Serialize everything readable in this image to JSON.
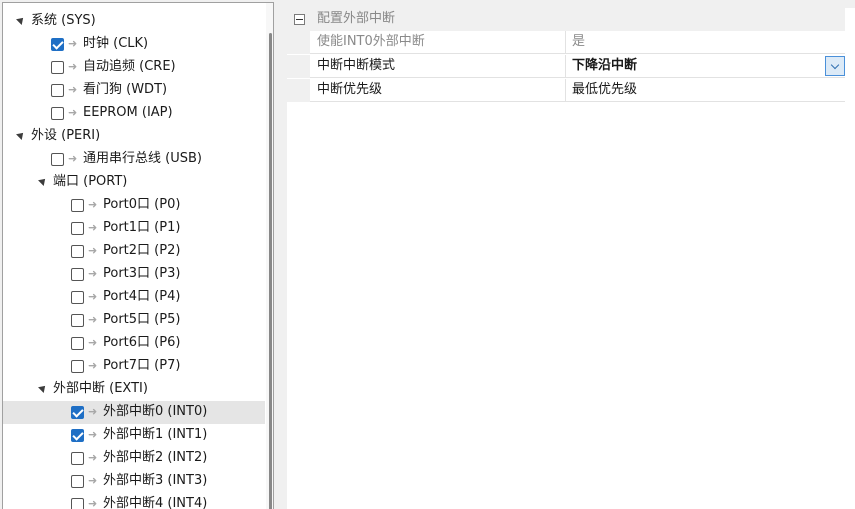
{
  "tree": {
    "nodes": [
      {
        "level": 0,
        "type": "group",
        "label": "系统 (SYS)"
      },
      {
        "level": 1,
        "type": "item",
        "checked": true,
        "label": "时钟 (CLK)"
      },
      {
        "level": 1,
        "type": "item",
        "checked": false,
        "label": "自动追频 (CRE)"
      },
      {
        "level": 1,
        "type": "item",
        "checked": false,
        "label": "看门狗 (WDT)"
      },
      {
        "level": 1,
        "type": "item",
        "checked": false,
        "label": "EEPROM (IAP)"
      },
      {
        "level": 0,
        "type": "group",
        "label": "外设 (PERI)"
      },
      {
        "level": 1,
        "type": "item",
        "checked": false,
        "label": "通用串行总线 (USB)"
      },
      {
        "level": 1,
        "type": "group",
        "label": "端口 (PORT)"
      },
      {
        "level": 2,
        "type": "item",
        "checked": false,
        "label": "Port0口 (P0)"
      },
      {
        "level": 2,
        "type": "item",
        "checked": false,
        "label": "Port1口 (P1)"
      },
      {
        "level": 2,
        "type": "item",
        "checked": false,
        "label": "Port2口 (P2)"
      },
      {
        "level": 2,
        "type": "item",
        "checked": false,
        "label": "Port3口 (P3)"
      },
      {
        "level": 2,
        "type": "item",
        "checked": false,
        "label": "Port4口 (P4)"
      },
      {
        "level": 2,
        "type": "item",
        "checked": false,
        "label": "Port5口 (P5)"
      },
      {
        "level": 2,
        "type": "item",
        "checked": false,
        "label": "Port6口 (P6)"
      },
      {
        "level": 2,
        "type": "item",
        "checked": false,
        "label": "Port7口 (P7)"
      },
      {
        "level": 1,
        "type": "group",
        "label": "外部中断 (EXTI)"
      },
      {
        "level": 2,
        "type": "item",
        "checked": true,
        "selected": true,
        "label": "外部中断0 (INT0)"
      },
      {
        "level": 2,
        "type": "item",
        "checked": true,
        "label": "外部中断1 (INT1)"
      },
      {
        "level": 2,
        "type": "item",
        "checked": false,
        "label": "外部中断2 (INT2)"
      },
      {
        "level": 2,
        "type": "item",
        "checked": false,
        "label": "外部中断3 (INT3)"
      },
      {
        "level": 2,
        "type": "item",
        "checked": false,
        "label": "外部中断4 (INT4)"
      }
    ]
  },
  "grid": {
    "category": "配置外部中断",
    "properties": [
      {
        "name": "使能INT0外部中断",
        "value": "是",
        "disabled": true
      },
      {
        "name": "中断中断模式",
        "value": "下降沿中断",
        "bold": true,
        "dropdown": true
      },
      {
        "name": "中断优先级",
        "value": "最低优先级"
      }
    ]
  },
  "colors": {
    "check_accent": "#1f6fc5",
    "selected_row": "#e5e5e5",
    "grid_line": "#e2e2e2"
  }
}
